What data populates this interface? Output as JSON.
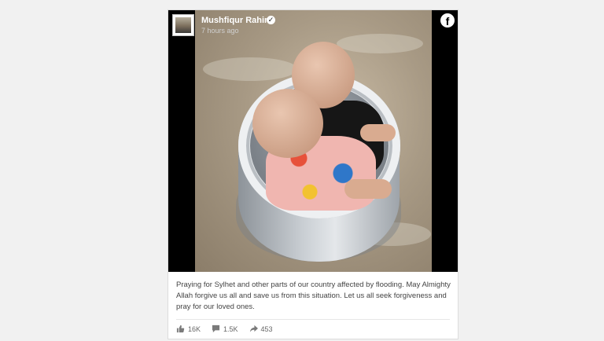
{
  "post": {
    "author": "Mushfiqur Rahim",
    "time": "7 hours ago",
    "caption": "Praying for Sylhet and other parts of our country affected by flooding. May Almighty Allah forgive us all and save us from this situation. Let us all seek forgiveness and pray for our loved ones.",
    "stats": {
      "likes": "16K",
      "comments": "1.5K",
      "shares": "453"
    }
  },
  "icons": {
    "verified": "verified-badge-icon",
    "brand": "facebook-icon",
    "like": "thumbs-up-icon",
    "comment": "comment-icon",
    "share": "share-arrow-icon"
  },
  "colors": {
    "background": "#f1f1f1",
    "media_background": "#000000"
  }
}
